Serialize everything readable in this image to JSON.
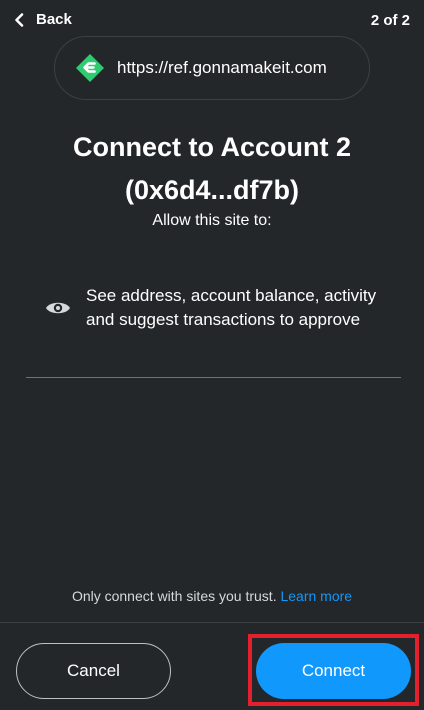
{
  "header": {
    "back_label": "Back",
    "step": "2 of 2"
  },
  "site": {
    "url": "https://ref.gonnamakeit.com",
    "favicon_icon": "gonnamakeit-logo-icon",
    "favicon_color": "#2ecc71"
  },
  "main": {
    "title_line1": "Connect to Account 2",
    "title_line2": "(0x6d4...df7b)",
    "subtitle": "Allow this site to:",
    "permission_icon": "eye-icon",
    "permission_text": "See address, account balance, activity and suggest transactions to approve"
  },
  "footer": {
    "trust_note": "Only connect with sites you trust.",
    "learn_more": "Learn more",
    "cancel_label": "Cancel",
    "connect_label": "Connect"
  },
  "colors": {
    "background": "#24272a",
    "primary": "#1098fc",
    "highlight": "#e5202e"
  }
}
